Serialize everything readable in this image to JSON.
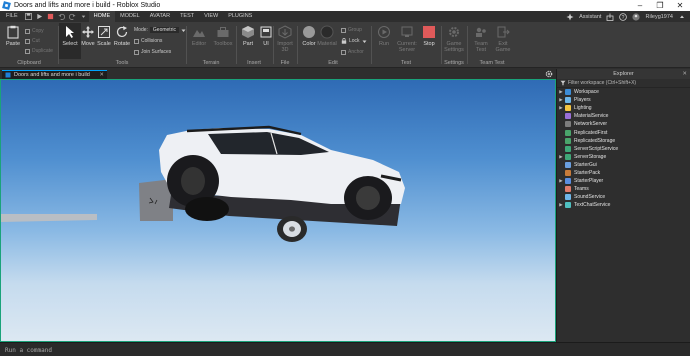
{
  "window": {
    "title": "Doors and lifts and more i build - Roblox Studio",
    "controls": [
      "–",
      "❐",
      "✕"
    ]
  },
  "menu": {
    "file_label": "FILE",
    "tabs": [
      "HOME",
      "MODEL",
      "AVATAR",
      "TEST",
      "VIEW",
      "PLUGINS"
    ],
    "active_tab": "HOME",
    "assistant_label": "Assistant",
    "username": "Rileyg1974"
  },
  "ribbon": {
    "clipboard": {
      "paste": "Paste",
      "copy": "Copy",
      "cut": "Cut",
      "duplicate": "Duplicate",
      "group": "Clipboard"
    },
    "tools": {
      "select": "Select",
      "move": "Move",
      "scale": "Scale",
      "rotate": "Rotate",
      "mode_label": "Mode:",
      "mode_value": "Geometric",
      "collisions": "Collisions",
      "join_surfaces": "Join Surfaces",
      "group": "Tools"
    },
    "terrain": {
      "editor": "Editor",
      "toolbox": "Toolbox",
      "group": "Terrain"
    },
    "insert": {
      "part": "Part",
      "ui": "UI",
      "group": "Insert"
    },
    "file": {
      "import3d": "Import 3D",
      "group": "File"
    },
    "edit": {
      "color": "Color",
      "material": "Material",
      "group_btn": "Group",
      "lock": "Lock",
      "anchor": "Anchor",
      "group": "Edit"
    },
    "test": {
      "run": "Run",
      "current_server": "Current: Server",
      "stop": "Stop",
      "group": "Test"
    },
    "settings": {
      "game_settings": "Game Settings",
      "group": "Settings"
    },
    "team_test": {
      "team_test": "Team Test",
      "exit_game": "Exit Game",
      "group": "Team Test"
    }
  },
  "document_tab": {
    "label": "Doors and lifts and more i build"
  },
  "explorer": {
    "title": "Explorer",
    "filter_placeholder": "Filter workspace (Ctrl+Shift+X)",
    "items": [
      {
        "label": "Workspace",
        "expandable": true,
        "icon_color": "#3c8cd6"
      },
      {
        "label": "Players",
        "expandable": true,
        "icon_color": "#6fb7ea"
      },
      {
        "label": "Lighting",
        "expandable": true,
        "icon_color": "#f5c542"
      },
      {
        "label": "MaterialService",
        "expandable": false,
        "icon_color": "#9a6fd8"
      },
      {
        "label": "NetworkServer",
        "expandable": false,
        "icon_color": "#7d7d7d"
      },
      {
        "label": "ReplicatedFirst",
        "expandable": false,
        "icon_color": "#4aa46a"
      },
      {
        "label": "ReplicatedStorage",
        "expandable": false,
        "icon_color": "#4aa46a"
      },
      {
        "label": "ServerScriptService",
        "expandable": false,
        "icon_color": "#3fa878"
      },
      {
        "label": "ServerStorage",
        "expandable": true,
        "icon_color": "#3fa878"
      },
      {
        "label": "StarterGui",
        "expandable": false,
        "icon_color": "#6a9fe0"
      },
      {
        "label": "StarterPack",
        "expandable": false,
        "icon_color": "#c77b3a"
      },
      {
        "label": "StarterPlayer",
        "expandable": true,
        "icon_color": "#5a8ee0"
      },
      {
        "label": "Teams",
        "expandable": false,
        "icon_color": "#e07b6a"
      },
      {
        "label": "SoundService",
        "expandable": false,
        "icon_color": "#6fb7ea"
      },
      {
        "label": "TextChatService",
        "expandable": true,
        "icon_color": "#4fc0c0"
      }
    ]
  },
  "command_bar": {
    "placeholder": "Run a command"
  },
  "colors": {
    "accent": "#00a2ff",
    "stop": "#e05a5a",
    "viewport_border": "#1aa37a"
  }
}
